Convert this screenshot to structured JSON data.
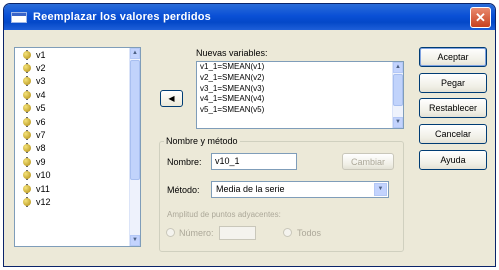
{
  "window": {
    "title": "Reemplazar los valores perdidos",
    "close_glyph": "✕"
  },
  "variables": {
    "icon": "scale-variable-icon",
    "items": [
      "v1",
      "v2",
      "v3",
      "v4",
      "v5",
      "v6",
      "v7",
      "v8",
      "v9",
      "v10",
      "v11",
      "v12"
    ]
  },
  "new_vars": {
    "label": "Nuevas variables:",
    "items": [
      "v1_1=SMEAN(v1)",
      "v2_1=SMEAN(v2)",
      "v3_1=SMEAN(v3)",
      "v4_1=SMEAN(v4)",
      "v5_1=SMEAN(v5)"
    ]
  },
  "move_button": {
    "glyph": "◀"
  },
  "group": {
    "title": "Nombre y método",
    "name_label": "Nombre:",
    "name_value": "v10_1",
    "change_label": "Cambiar",
    "method_label": "Método:",
    "method_value": "Media de la serie",
    "span_label": "Amplitud de puntos adyacentes:",
    "number_label": "Número:",
    "all_label": "Todos"
  },
  "buttons": {
    "accept": "Aceptar",
    "paste": "Pegar",
    "reset": "Restablecer",
    "cancel": "Cancelar",
    "help": "Ayuda"
  }
}
